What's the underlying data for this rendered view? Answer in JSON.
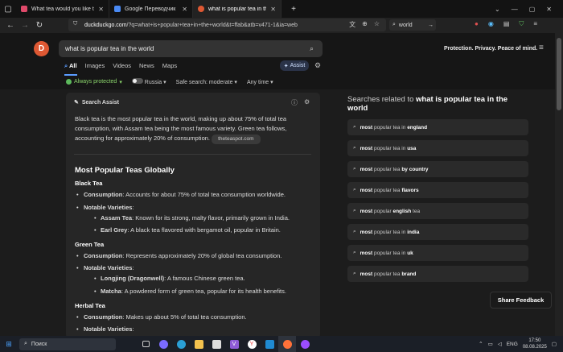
{
  "browser": {
    "tabs": [
      {
        "title": "What tea would you like to try?",
        "color": "#e04a6a",
        "active": false
      },
      {
        "title": "Google Переводчик",
        "color": "#4a8af4",
        "active": false
      },
      {
        "title": "what is popular tea in the world",
        "color": "#de5833",
        "active": true
      }
    ],
    "new_tab": "+",
    "url_domain": "duckduckgo.com",
    "url_rest": "/?q=what+is+popular+tea+in+the+world&t=ffab&atb=v471-1&ia=web",
    "search_box": "world"
  },
  "ddg": {
    "query": "what is popular tea in the world",
    "tagline": "Protection. Privacy. Peace of mind.",
    "tabs": [
      "All",
      "Images",
      "Videos",
      "News",
      "Maps"
    ],
    "assist_label": "Assist",
    "filters": {
      "protection": "Always protected",
      "region": "Russia",
      "safe_search": "Safe search: moderate",
      "time": "Any time"
    }
  },
  "answer": {
    "header": "Search Assist",
    "intro": "Black tea is the most popular tea in the world, making up about 75% of total tea consumption, with Assam tea being the most famous variety. Green tea follows, accounting for approximately 20% of consumption.",
    "source": "theteaspot.com",
    "heading": "Most Popular Teas Globally",
    "black_tea": "Black Tea",
    "consumption_label": "Consumption",
    "black_consumption": ": Accounts for about 75% of total tea consumption worldwide.",
    "notable_label": "Notable Varieties",
    "colon": ":",
    "assam_name": "Assam Tea",
    "assam_desc": ": Known for its strong, malty flavor, primarily grown in India.",
    "earl_name": "Earl Grey",
    "earl_desc": ": A black tea flavored with bergamot oil, popular in Britain.",
    "green_tea": "Green Tea",
    "green_consumption": ": Represents approximately 20% of global tea consumption.",
    "longjing_name": "Longjing (Dragonwell)",
    "longjing_desc": ": A famous Chinese green tea.",
    "matcha_name": "Matcha",
    "matcha_desc": ": A powdered form of green tea, popular for its health benefits.",
    "herbal_tea": "Herbal Tea",
    "herbal_consumption": ": Makes up about 5% of total tea consumption."
  },
  "related": {
    "title_prefix": "Searches related to ",
    "title_query": "what is popular tea in the world",
    "items": [
      {
        "bold": "most",
        "plain": " popular tea in ",
        "bold2": "england"
      },
      {
        "bold": "most",
        "plain": " popular tea in ",
        "bold2": "usa"
      },
      {
        "bold": "most",
        "plain": " popular tea ",
        "bold2": "by country"
      },
      {
        "bold": "most",
        "plain": " popular tea ",
        "bold2": "flavors"
      },
      {
        "bold": "most",
        "plain": " popular ",
        "bold2": "english",
        "tail": " tea"
      },
      {
        "bold": "most",
        "plain": " popular tea in ",
        "bold2": "india"
      },
      {
        "bold": "most",
        "plain": " popular tea in ",
        "bold2": "uk"
      },
      {
        "bold": "most",
        "plain": " popular tea ",
        "bold2": "brand"
      }
    ]
  },
  "share_feedback": "Share Feedback",
  "taskbar": {
    "search": "Поиск",
    "lang": "ENG",
    "time": "17:50",
    "date": "08.08.2025"
  },
  "colors": {
    "accent": "#de5833",
    "link_blue": "#5b9cff",
    "protected_green": "#8ad36b"
  }
}
